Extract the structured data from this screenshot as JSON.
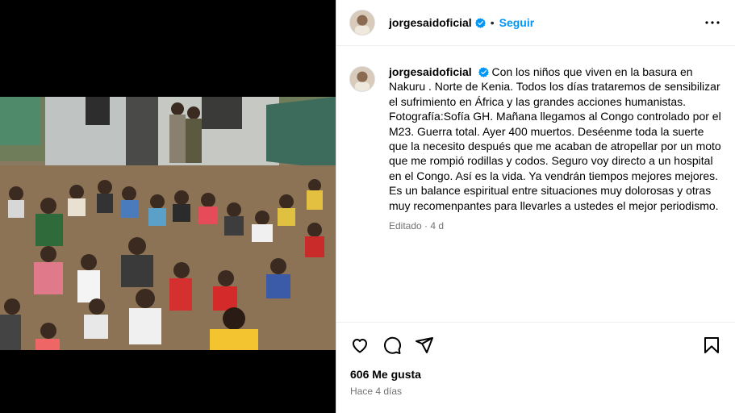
{
  "post": {
    "username": "jorgesaidoficial",
    "follow_label": "Seguir",
    "separator": "•",
    "caption": "Con los niños que viven en la basura en Nakuru . Norte de Kenia. Todos los días trataremos de sensibilizar el sufrimiento en África y las grandes acciones humanistas. Fotografía:Sofía GH. Mañana llegamos al Congo controlado por el M23. Guerra total. Ayer 400 muertos. Deséenme toda la suerte que la necesito después que me acaban de atropellar por un moto que me rompió rodillas y codos. Seguro voy directo a un hospital en el Congo. Así es la vida. Ya vendrán tiempos mejores mejores. Es un balance espiritual entre situaciones muy dolorosas y otras muy recomenpantes para llevarles a ustedes el mejor periodismo.",
    "edited_meta": "Editado · 4 d",
    "likes": "606 Me gusta",
    "time_ago": "Hace 4 días"
  },
  "icons": {
    "more": "more-options-icon",
    "like": "heart-icon",
    "comment": "comment-icon",
    "share": "paper-plane-icon",
    "save": "bookmark-icon",
    "verified": "verified-badge-icon"
  },
  "colors": {
    "accent": "#0095f6",
    "verified": "#0095f6",
    "muted": "#737373"
  }
}
